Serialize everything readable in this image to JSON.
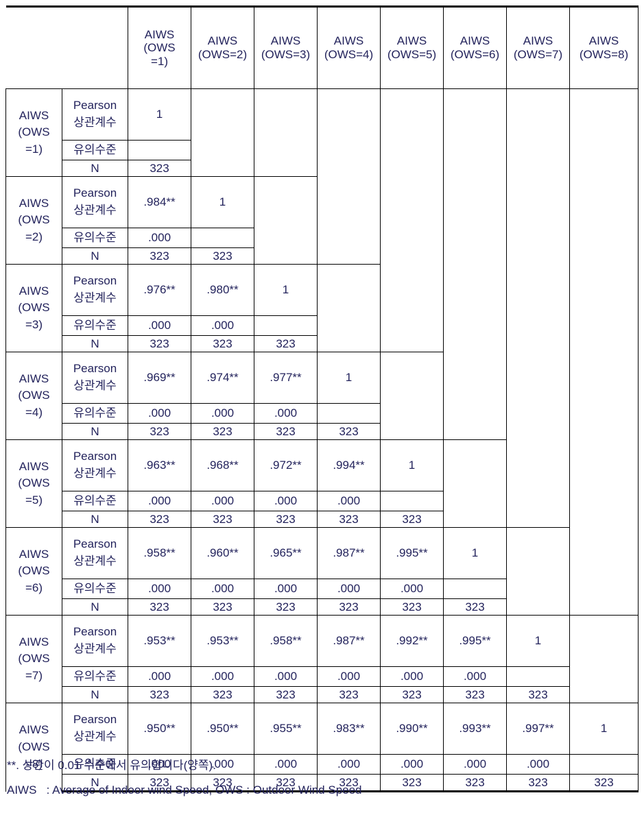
{
  "table": {
    "corner_label": "",
    "column_headers": [
      "AIWS\n(OWS\n=1)",
      "AIWS\n(OWS=2)",
      "AIWS\n(OWS=3)",
      "AIWS\n(OWS=4)",
      "AIWS\n(OWS=5)",
      "AIWS\n(OWS=6)",
      "AIWS\n(OWS=7)",
      "AIWS\n(OWS=8)"
    ],
    "measure_labels": {
      "pearson": "Pearson\n상관계수",
      "sig": "유의수준",
      "n": "N"
    },
    "rows": [
      {
        "label": "AIWS\n(OWS\n=1)",
        "pearson": [
          "1"
        ],
        "sig": [
          ""
        ],
        "n": [
          "323"
        ]
      },
      {
        "label": "AIWS\n(OWS\n=2)",
        "pearson": [
          ".984**",
          "1"
        ],
        "sig": [
          ".000",
          ""
        ],
        "n": [
          "323",
          "323"
        ]
      },
      {
        "label": "AIWS\n(OWS\n=3)",
        "pearson": [
          ".976**",
          ".980**",
          "1"
        ],
        "sig": [
          ".000",
          ".000",
          ""
        ],
        "n": [
          "323",
          "323",
          "323"
        ]
      },
      {
        "label": "AIWS\n(OWS\n=4)",
        "pearson": [
          ".969**",
          ".974**",
          ".977**",
          "1"
        ],
        "sig": [
          ".000",
          ".000",
          ".000",
          ""
        ],
        "n": [
          "323",
          "323",
          "323",
          "323"
        ]
      },
      {
        "label": "AIWS\n(OWS\n=5)",
        "pearson": [
          ".963**",
          ".968**",
          ".972**",
          ".994**",
          "1"
        ],
        "sig": [
          ".000",
          ".000",
          ".000",
          ".000",
          ""
        ],
        "n": [
          "323",
          "323",
          "323",
          "323",
          "323"
        ]
      },
      {
        "label": "AIWS\n(OWS\n=6)",
        "pearson": [
          ".958**",
          ".960**",
          ".965**",
          ".987**",
          ".995**",
          "1"
        ],
        "sig": [
          ".000",
          ".000",
          ".000",
          ".000",
          ".000",
          ""
        ],
        "n": [
          "323",
          "323",
          "323",
          "323",
          "323",
          "323"
        ]
      },
      {
        "label": "AIWS\n(OWS\n=7)",
        "pearson": [
          ".953**",
          ".953**",
          ".958**",
          ".987**",
          ".992**",
          ".995**",
          "1"
        ],
        "sig": [
          ".000",
          ".000",
          ".000",
          ".000",
          ".000",
          ".000",
          ""
        ],
        "n": [
          "323",
          "323",
          "323",
          "323",
          "323",
          "323",
          "323"
        ]
      },
      {
        "label": "AIWS\n(OWS\n=8)",
        "pearson": [
          ".950**",
          ".950**",
          ".955**",
          ".983**",
          ".990**",
          ".993**",
          ".997**",
          "1"
        ],
        "sig": [
          ".000",
          ".000",
          ".000",
          ".000",
          ".000",
          ".000",
          ".000",
          ""
        ],
        "n": [
          "323",
          "323",
          "323",
          "323",
          "323",
          "323",
          "323",
          "323"
        ]
      }
    ]
  },
  "footnotes": [
    "**. 상관이 0.01 수준에서 유의합니다(양쪽).",
    "AIWS   : Average of Indoor wind Speed, OWS : Outdoor Wind Speed"
  ]
}
